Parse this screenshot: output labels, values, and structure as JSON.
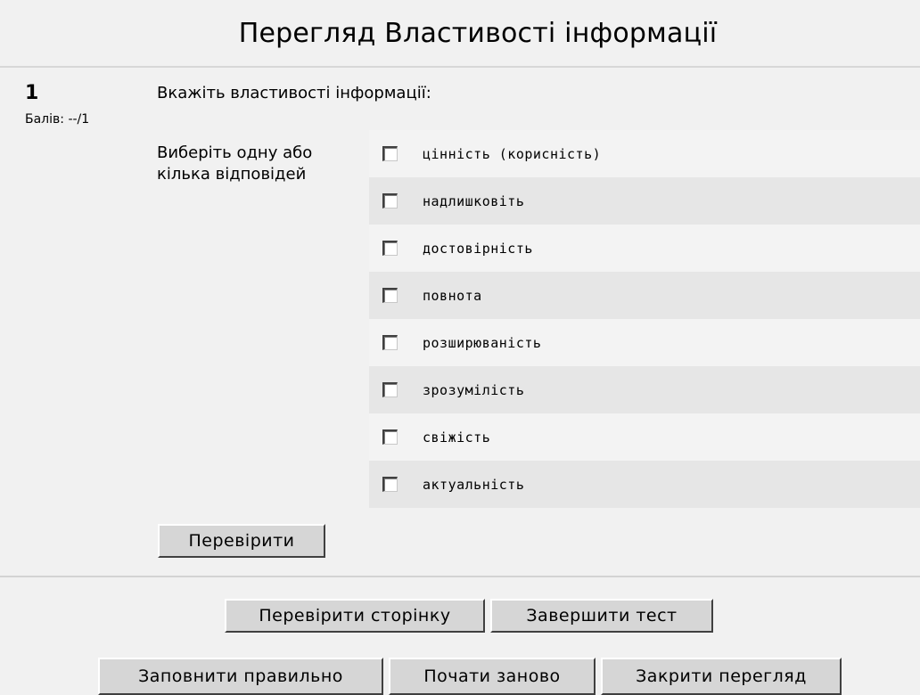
{
  "header": {
    "title": "Перегляд Властивості інформації"
  },
  "question": {
    "number": "1",
    "grade_label": "Балів:",
    "grade_value": "--/1",
    "text": "Вкажіть властивості інформації:",
    "prompt": "Виберіть одну або кілька відповідей",
    "options": [
      {
        "label": "цінність (корисність)",
        "checked": false
      },
      {
        "label": "надлишковіть",
        "checked": false
      },
      {
        "label": "достовірність",
        "checked": false
      },
      {
        "label": "повнота",
        "checked": false
      },
      {
        "label": "розширюваність",
        "checked": false
      },
      {
        "label": "зрозумілість",
        "checked": false
      },
      {
        "label": "свіжість",
        "checked": false
      },
      {
        "label": "актуальність",
        "checked": false
      }
    ],
    "check_label": "Перевірити"
  },
  "navigation": {
    "check_page_label": "Перевірити сторінку",
    "finish_label": "Завершити тест",
    "fill_correct_label": "Заповнити правильно",
    "restart_label": "Почати заново",
    "close_preview_label": "Закрити перегляд"
  }
}
